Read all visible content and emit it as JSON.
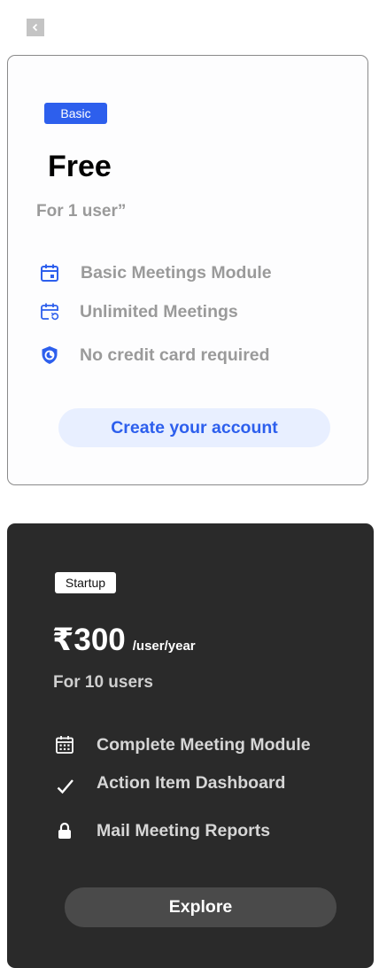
{
  "nav": {
    "back_icon": "chevron-left-icon"
  },
  "basic_plan": {
    "badge": "Basic",
    "price": "Free",
    "users": "For 1 user”",
    "features": [
      {
        "icon": "calendar-icon",
        "label": "Basic Meetings Module"
      },
      {
        "icon": "calendar-refresh-icon",
        "label": "Unlimited Meetings"
      },
      {
        "icon": "shield-icon",
        "label": "No credit card required"
      }
    ],
    "cta": "Create your account",
    "accent_color": "#2d5fed"
  },
  "startup_plan": {
    "badge": "Startup",
    "price": "₹300",
    "price_unit": "/user/year",
    "users": "For 10 users",
    "features": [
      {
        "icon": "calendar-grid-icon",
        "label": "Complete Meeting Module"
      },
      {
        "icon": "checkmark-icon",
        "label": "Action Item Dashboard"
      },
      {
        "icon": "lock-icon",
        "label": "Mail Meeting Reports"
      }
    ],
    "cta": "Explore",
    "background_color": "#2a2a2a"
  }
}
